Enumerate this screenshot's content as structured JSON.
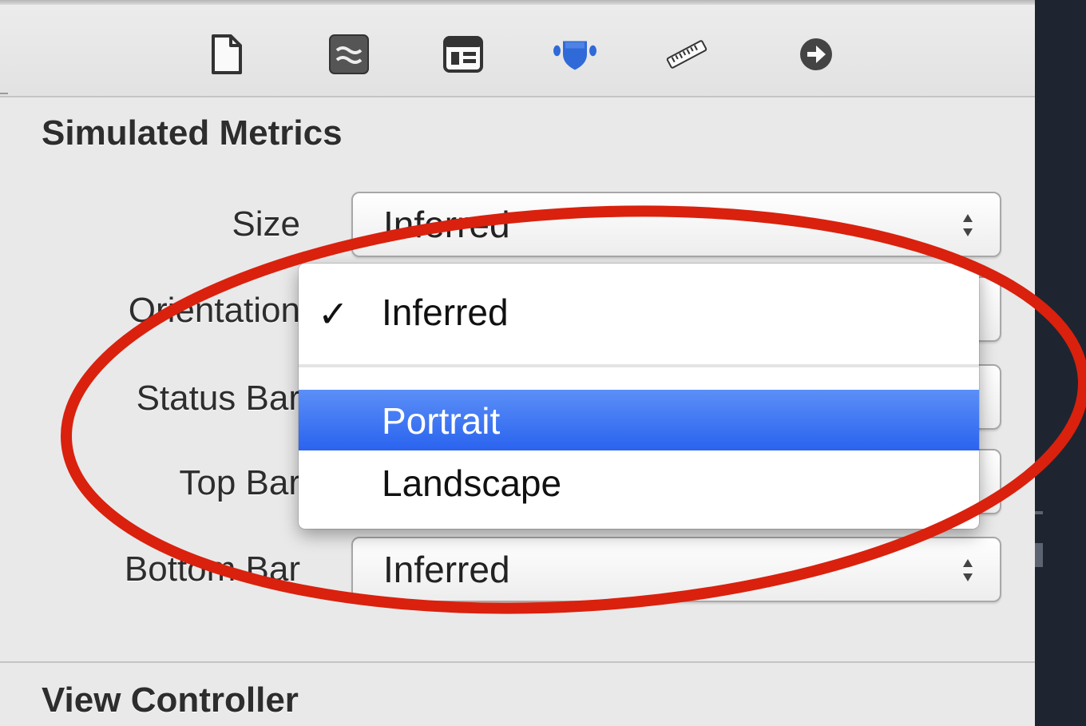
{
  "toolbar": {
    "icons": [
      {
        "name": "file-inspector-icon"
      },
      {
        "name": "quick-help-icon"
      },
      {
        "name": "identity-inspector-icon"
      },
      {
        "name": "attributes-inspector-icon",
        "selected": true,
        "color": "#2f6ad8"
      },
      {
        "name": "size-inspector-icon"
      },
      {
        "name": "connections-inspector-icon"
      }
    ]
  },
  "simulated_metrics": {
    "title": "Simulated Metrics",
    "size": {
      "label": "Size",
      "value": "Inferred"
    },
    "orientation": {
      "label": "Orientation"
    },
    "status_bar": {
      "label": "Status Bar"
    },
    "top_bar": {
      "label": "Top Bar"
    },
    "bottom_bar": {
      "label": "Bottom Bar",
      "value": "Inferred"
    }
  },
  "orientation_menu": {
    "items": [
      {
        "label": "Inferred",
        "checked": true,
        "check_mark": "✓"
      },
      {
        "label": "Portrait",
        "highlighted": true
      },
      {
        "label": "Landscape"
      }
    ],
    "highlight_color": "#2d67ef"
  },
  "view_controller": {
    "title": "View Controller"
  },
  "annotation": {
    "shape": "ellipse",
    "color": "#d9210e"
  }
}
